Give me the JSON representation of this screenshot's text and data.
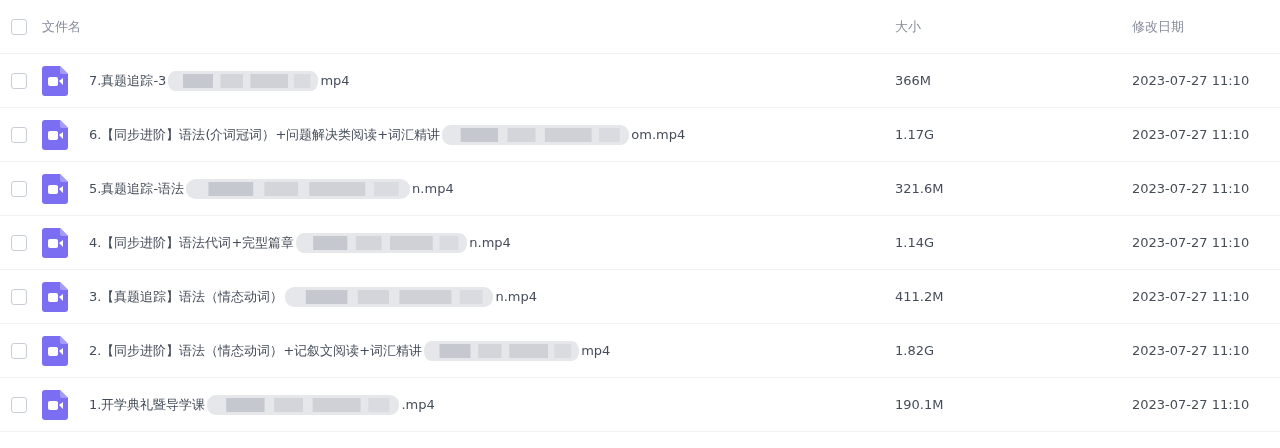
{
  "header": {
    "checked": false,
    "columns": [
      "文件名",
      "大小",
      "修改日期"
    ]
  },
  "files": [
    {
      "checked": false,
      "name_start": "7.真题追踪-3",
      "name_end": "mp4",
      "size": "366M",
      "modified": "2023-07-27 11:10"
    },
    {
      "checked": false,
      "name_start": "6.【同步进阶】语法(介词冠词）+问题解决类阅读+词汇精讲",
      "name_end": "om.mp4",
      "size": "1.17G",
      "modified": "2023-07-27 11:10"
    },
    {
      "checked": false,
      "name_start": "5.真题追踪-语法",
      "name_end": "n.mp4",
      "size": "321.6M",
      "modified": "2023-07-27 11:10"
    },
    {
      "checked": false,
      "name_start": "4.【同步进阶】语法代词+完型篇章",
      "name_end": "n.mp4",
      "size": "1.14G",
      "modified": "2023-07-27 11:10"
    },
    {
      "checked": false,
      "name_start": "3.【真题追踪】语法（情态动词）",
      "name_end": "n.mp4",
      "size": "411.2M",
      "modified": "2023-07-27 11:10"
    },
    {
      "checked": false,
      "name_start": "2.【同步进阶】语法（情态动词）+记叙文阅读+词汇精讲",
      "name_end": "mp4",
      "size": "1.82G",
      "modified": "2023-07-27 11:10"
    },
    {
      "checked": false,
      "name_start": "1.开学典礼暨导学课",
      "name_end": ".mp4",
      "size": "190.1M",
      "modified": "2023-07-27 11:10"
    }
  ]
}
